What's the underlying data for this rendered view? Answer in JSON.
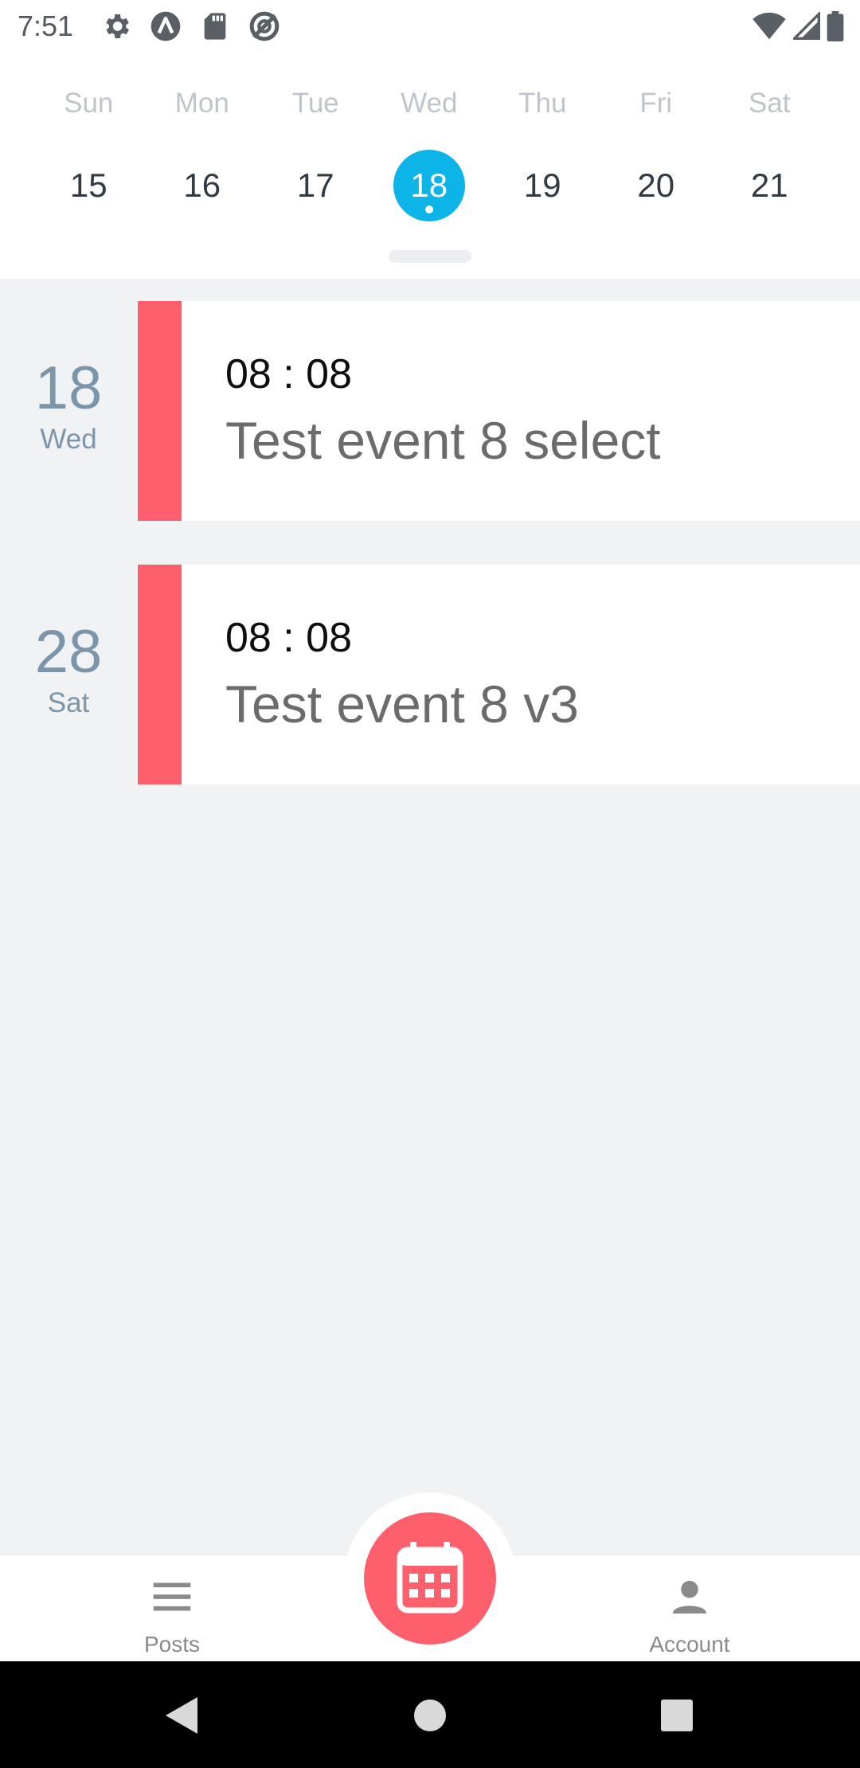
{
  "status_bar": {
    "time": "7:51",
    "left_icons": [
      "gear-icon",
      "notification-a-icon",
      "sd-card-icon",
      "no-entry-icon"
    ],
    "right_icons": [
      "wifi-icon",
      "signal-icon",
      "battery-icon"
    ]
  },
  "week": {
    "days": [
      {
        "name": "Sun",
        "date": "15"
      },
      {
        "name": "Mon",
        "date": "16"
      },
      {
        "name": "Tue",
        "date": "17"
      },
      {
        "name": "Wed",
        "date": "18",
        "selected": true
      },
      {
        "name": "Thu",
        "date": "19"
      },
      {
        "name": "Fri",
        "date": "20"
      },
      {
        "name": "Sat",
        "date": "21"
      }
    ],
    "selected_color": "#0db4e8"
  },
  "agenda": {
    "items": [
      {
        "day_number": "18",
        "day_name": "Wed",
        "time": "08 : 08",
        "title": "Test event 8 select"
      },
      {
        "day_number": "28",
        "day_name": "Sat",
        "time": "08 : 08",
        "title": "Test event 8 v3"
      }
    ],
    "accent_color": "#fe5f6c"
  },
  "bottom_nav": {
    "posts_label": "Posts",
    "account_label": "Account",
    "fab_icon": "calendar-icon",
    "fab_color": "#fe5f6c"
  },
  "system_nav": {
    "icons": [
      "back-icon",
      "home-icon",
      "recents-icon"
    ]
  }
}
